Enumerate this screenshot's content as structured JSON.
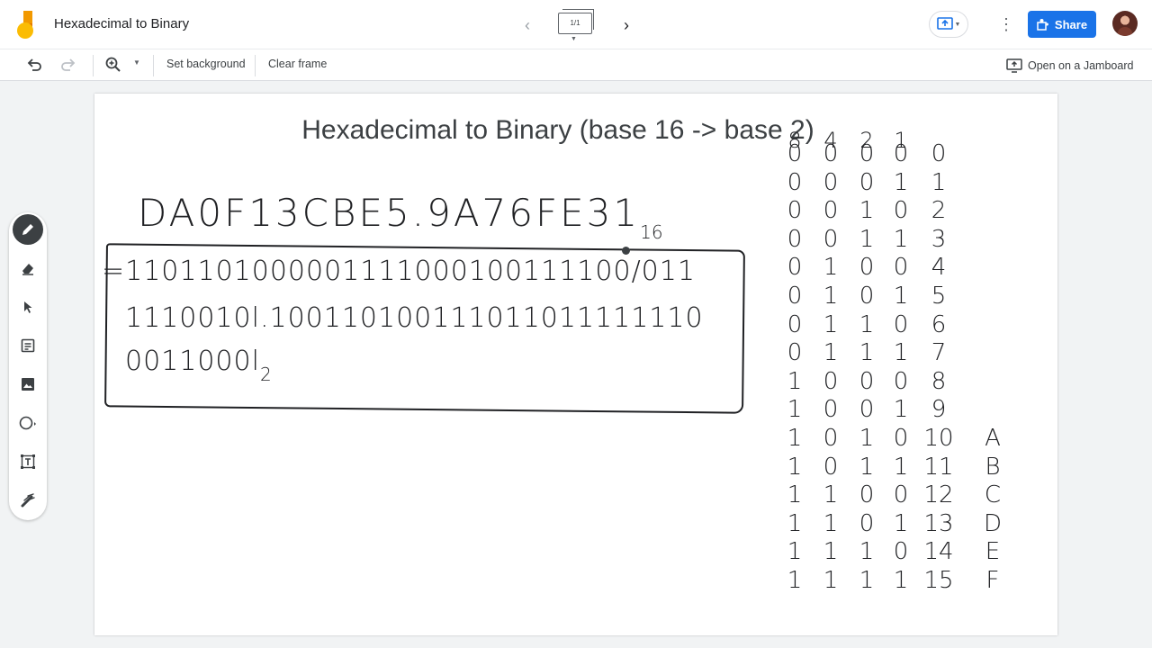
{
  "header": {
    "title": "Hexadecimal to Binary",
    "frame_counter": "1/1",
    "share_label": "Share"
  },
  "toolbar": {
    "set_background": "Set background",
    "clear_frame": "Clear frame",
    "open_on_jamboard": "Open on a Jamboard"
  },
  "canvas": {
    "title": "Hexadecimal to Binary (base 16 -> base 2)",
    "hex_number": "DA0F13CBE5.9A76FE31",
    "hex_base": "16",
    "binary_lines": [
      "=1101101000001111000100111100/011",
      "1110010l.100110100111011011111110",
      "0011000l"
    ],
    "binary_base": "2",
    "table_header": [
      "8",
      "4",
      "2",
      "1"
    ],
    "table_rows": [
      [
        "0",
        "0",
        "0",
        "0",
        "0",
        ""
      ],
      [
        "0",
        "0",
        "0",
        "1",
        "1",
        ""
      ],
      [
        "0",
        "0",
        "1",
        "0",
        "2",
        ""
      ],
      [
        "0",
        "0",
        "1",
        "1",
        "3",
        ""
      ],
      [
        "0",
        "1",
        "0",
        "0",
        "4",
        ""
      ],
      [
        "0",
        "1",
        "0",
        "1",
        "5",
        ""
      ],
      [
        "0",
        "1",
        "1",
        "0",
        "6",
        ""
      ],
      [
        "0",
        "1",
        "1",
        "1",
        "7",
        ""
      ],
      [
        "1",
        "0",
        "0",
        "0",
        "8",
        ""
      ],
      [
        "1",
        "0",
        "0",
        "1",
        "9",
        ""
      ],
      [
        "1",
        "0",
        "1",
        "0",
        "10",
        "A"
      ],
      [
        "1",
        "0",
        "1",
        "1",
        "11",
        "B"
      ],
      [
        "1",
        "1",
        "0",
        "0",
        "12",
        "C"
      ],
      [
        "1",
        "1",
        "0",
        "1",
        "13",
        "D"
      ],
      [
        "1",
        "1",
        "1",
        "0",
        "14",
        "E"
      ],
      [
        "1",
        "1",
        "1",
        "1",
        "15",
        "F"
      ]
    ]
  },
  "colors": {
    "share_button": "#1a73e8",
    "ink": "#202124",
    "canvas_bg": "#ffffff",
    "app_bg": "#f1f3f4"
  },
  "icons": [
    "jamboard-logo-icon",
    "chevron-left-icon",
    "chevron-right-icon",
    "present-icon",
    "more-vert-icon",
    "share-people-icon",
    "undo-icon",
    "redo-icon",
    "zoom-icon",
    "open-jamboard-icon",
    "pen-icon",
    "eraser-icon",
    "select-icon",
    "sticky-note-icon",
    "image-icon",
    "circle-icon",
    "text-box-icon",
    "laser-icon"
  ]
}
